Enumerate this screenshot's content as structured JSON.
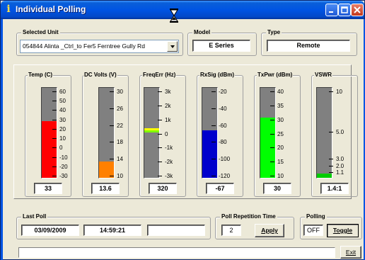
{
  "window": {
    "title": "Individual Polling",
    "title_icon": "info-icon",
    "buttons": [
      "minimize-icon",
      "maximize-icon",
      "close-icon"
    ]
  },
  "selected_unit": {
    "label": "Selected Unit",
    "value": "054844 Alinta _Ctrl_to Fer5 Ferntree Gully Rd"
  },
  "model": {
    "label": "Model",
    "value": "E Series"
  },
  "type": {
    "label": "Type",
    "value": "Remote"
  },
  "meters": [
    {
      "title": "Temp (C)",
      "ticks": [
        "60",
        "50",
        "40",
        "30",
        "20",
        "10",
        "0",
        "-10",
        "-20",
        "-30"
      ],
      "value": "33",
      "fill_fraction": 0.63,
      "fill_color": "#ff0000"
    },
    {
      "title": "DC Volts (V)",
      "ticks": [
        "30",
        "26",
        "22",
        "18",
        "14",
        "10"
      ],
      "value": "13.6",
      "fill_fraction": 0.18,
      "fill_color": "#ff8000"
    },
    {
      "title": "FreqErr (Hz)",
      "ticks": [
        "3k",
        "2k",
        "1k",
        "0",
        "-1k",
        "-2k",
        "-3k"
      ],
      "value": "320",
      "marker_fraction": 0.53,
      "fill_color": "#ffff00",
      "marker_color": "#80ff00"
    },
    {
      "title": "RxSig (dBm)",
      "ticks": [
        "-20",
        "-40",
        "-60",
        "-80",
        "-100",
        "-120"
      ],
      "value": "-67",
      "fill_fraction": 0.53,
      "fill_color": "#0000cc"
    },
    {
      "title": "TxPwr (dBm)",
      "ticks": [
        "40",
        "35",
        "30",
        "25",
        "20",
        "15",
        "10"
      ],
      "value": "30",
      "fill_fraction": 0.67,
      "fill_color": "#00ff00"
    },
    {
      "title": "VSWR",
      "ticks": [
        "10",
        "5.0",
        "3.0",
        "2.0",
        "1.1"
      ],
      "value": "1.4:1",
      "fill_fraction": 0.05,
      "fill_color": "#00cc00"
    }
  ],
  "last_poll": {
    "label": "Last Poll",
    "date": "03/09/2009",
    "time": "14:59:21",
    "extra": ""
  },
  "poll_repetition": {
    "label": "Poll Repetition Time",
    "value": "2",
    "apply_label": "Apply"
  },
  "polling": {
    "label": "Polling",
    "state": "OFF",
    "toggle_label": "Toggle"
  },
  "status_text": "",
  "exit_label": "Exit",
  "colors": {
    "title_bar": "#0054e3",
    "face": "#ece9d8",
    "track": "#808080"
  }
}
